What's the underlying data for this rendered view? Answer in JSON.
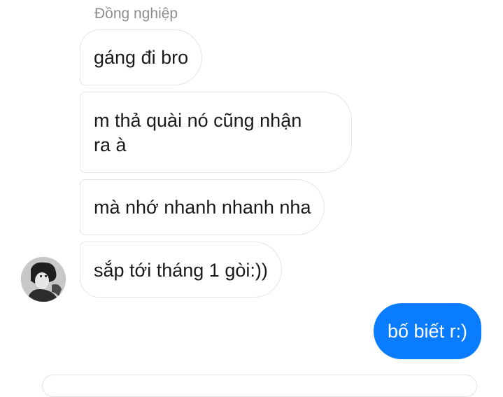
{
  "conversation": {
    "sender_name": "Đồng nghiệp",
    "incoming_messages": [
      "gáng đi bro",
      "m thả quài nó cũng nhận\nra à",
      "mà nhớ nhanh nhanh nha",
      "sắp tới tháng 1 gòi:))"
    ],
    "outgoing_messages": [
      "bố biết r:)"
    ]
  },
  "colors": {
    "outgoing_bubble": "#0a7cff",
    "incoming_bubble_border": "#e4e4e4",
    "sender_name_text": "#8e8e8e"
  },
  "icons": {
    "avatar": "contact-avatar-photo"
  }
}
